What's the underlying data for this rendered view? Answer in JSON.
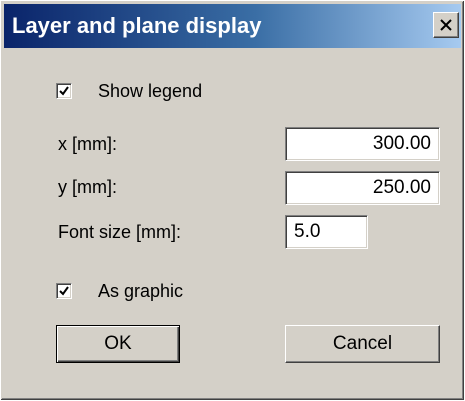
{
  "dialog": {
    "title": "Layer and plane display",
    "close_symbol": "X"
  },
  "show_legend": {
    "label": "Show legend",
    "checked": true
  },
  "fields": {
    "x_label": "x [mm]:",
    "x_value": "300.00",
    "y_label": "y [mm]:",
    "y_value": "250.00",
    "font_size_label": "Font size [mm]:",
    "font_size_value": "5.0"
  },
  "as_graphic": {
    "label": "As graphic",
    "checked": true
  },
  "buttons": {
    "ok_label": "OK",
    "cancel_label": "Cancel"
  },
  "icons": {
    "close": "close-icon",
    "check": "check-icon"
  },
  "colors": {
    "title_bar_start": "#0a246a",
    "title_bar_end": "#a6caf0",
    "dialog_face": "#d4d0c8"
  }
}
